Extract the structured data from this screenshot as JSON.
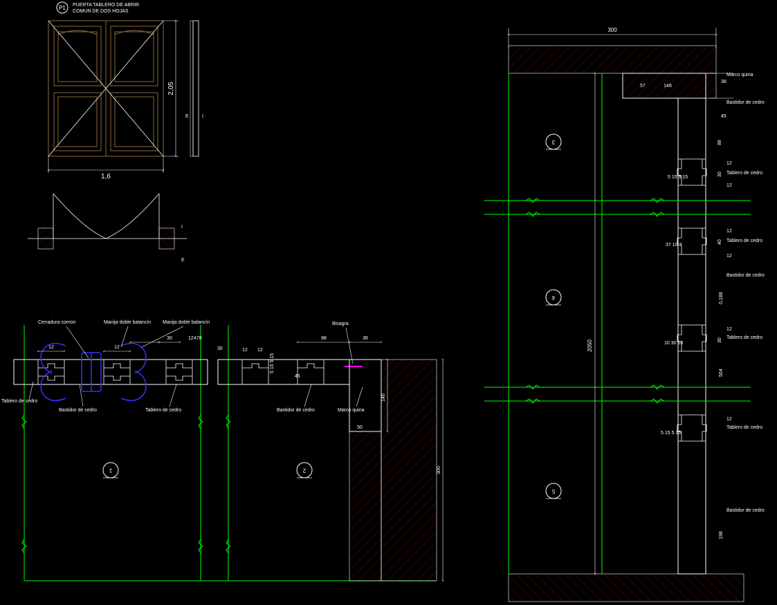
{
  "title": {
    "id": "P1",
    "line1": "PUERTA TABLERO DE ABRIR",
    "line2": "COMUN DE DOS HOJAS"
  },
  "elevation": {
    "width_label": "1,6",
    "height_label": "2,05",
    "right_marks": {
      "e": "E",
      "i": "I"
    }
  },
  "plan": {
    "marks": {
      "e": "E",
      "i": "I"
    }
  },
  "detail1": {
    "bubble": "1",
    "labels": {
      "cerradura": "Cerradura común",
      "manija1": "Manija doble balancín",
      "manija2": "Manija doble balancín",
      "tablero": "Tablero de cedro",
      "bastidor": "Bastidor de cedro",
      "tablero2": "Tablero de cedro"
    },
    "dims": {
      "d12a": "12",
      "d30a": "30",
      "d12b": "12",
      "d478": "478",
      "d12c": "12",
      "d30b": "30",
      "d12d": "12"
    }
  },
  "detail2": {
    "bubble": "2",
    "labels": {
      "bisagra": "Bisagra",
      "bastidor": "Bastidor de cedro",
      "marco": "Marco quina"
    },
    "dims": {
      "d88": "88",
      "d36": "36",
      "d12a": "12",
      "d12b": "12",
      "d5155": "5 15 5 15",
      "d45": "45",
      "d146": "146",
      "d50": "50",
      "d300": "300"
    }
  },
  "section": {
    "dims": {
      "top300": "300",
      "d2050": "2050",
      "d146": "146",
      "d57": "57",
      "d38": "38",
      "d45": "45",
      "d88": "88",
      "d30a": "30",
      "d12": "12",
      "d0188": "0,188",
      "d504": "504",
      "d198": "198",
      "d5155": "5 15 5 15",
      "d40": "40",
      "d37107": "37 10 7",
      "d10301p": "10 30 10"
    },
    "labels": {
      "marco": "Marco quina",
      "bastidor1": "Bastidor de cedro",
      "tablero1": "Tablero de cedro",
      "tablero2": "Tablero de cedro",
      "bastidor2": "Bastidor de cedro",
      "tablero3": "Tablero de cedro",
      "tablero4": "Tablero de cedro",
      "bastidor3": "Bastidor de cedro"
    },
    "bubbles": {
      "b3": "3",
      "b4": "4",
      "b5": "5"
    }
  }
}
